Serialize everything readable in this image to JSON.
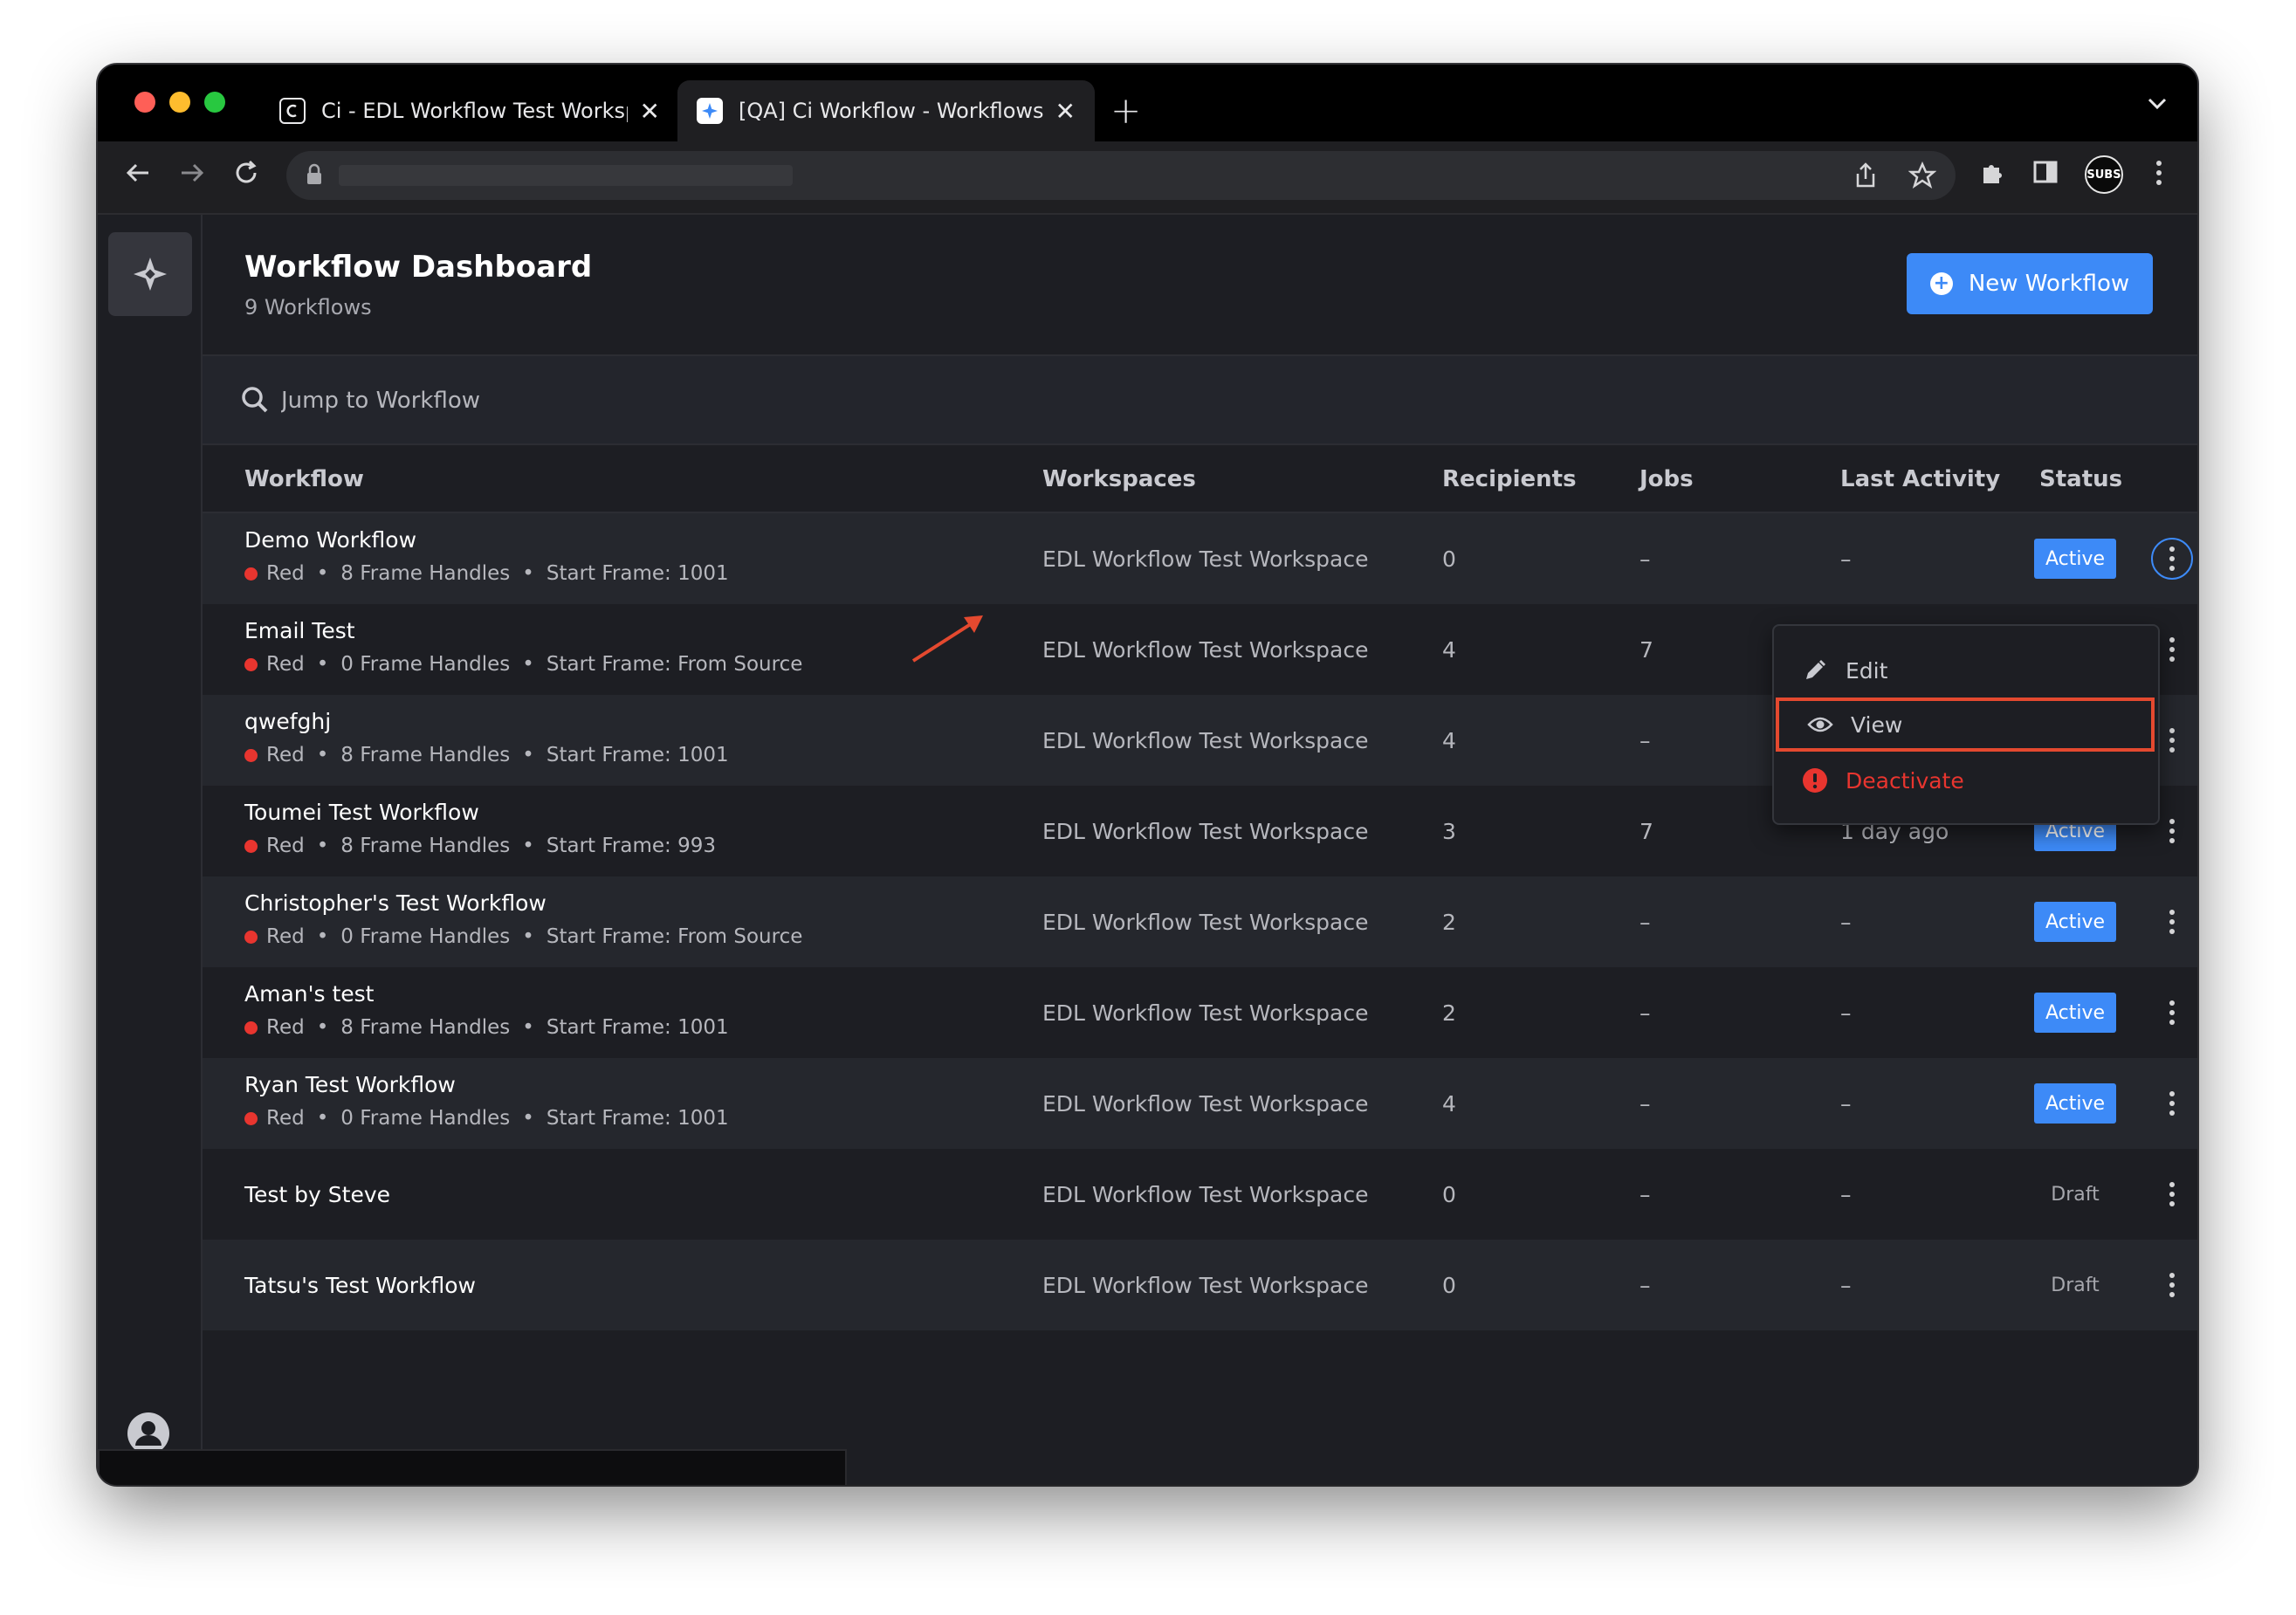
{
  "browser": {
    "tabs": [
      {
        "title": "Ci - EDL Workflow Test Workspace",
        "favicon": "ci-logo-icon",
        "active": false
      },
      {
        "title": "[QA] Ci Workflow - Workflows",
        "favicon": "workflow-diamond-icon",
        "active": true
      }
    ],
    "profile_label": "SUBS"
  },
  "header": {
    "title": "Workflow Dashboard",
    "subtitle": "9 Workflows",
    "new_button": "New Workflow"
  },
  "search": {
    "placeholder": "Jump to Workflow"
  },
  "table": {
    "columns": [
      "Workflow",
      "Workspaces",
      "Recipients",
      "Jobs",
      "Last Activity",
      "Status"
    ],
    "rows": [
      {
        "name": "Demo Workflow",
        "color": "Red",
        "handles": "8 Frame Handles",
        "start": "Start Frame: 1001",
        "workspace": "EDL Workflow Test Workspace",
        "recipients": "0",
        "jobs": "–",
        "last_activity": "–",
        "status": "Active"
      },
      {
        "name": "Email Test",
        "color": "Red",
        "handles": "0 Frame Handles",
        "start": "Start Frame: From Source",
        "workspace": "EDL Workflow Test Workspace",
        "recipients": "4",
        "jobs": "7",
        "last_activity": "",
        "status": ""
      },
      {
        "name": "qwefghj",
        "color": "Red",
        "handles": "8 Frame Handles",
        "start": "Start Frame: 1001",
        "workspace": "EDL Workflow Test Workspace",
        "recipients": "4",
        "jobs": "–",
        "last_activity": "",
        "status": ""
      },
      {
        "name": "Toumei Test Workflow",
        "color": "Red",
        "handles": "8 Frame Handles",
        "start": "Start Frame: 993",
        "workspace": "EDL Workflow Test Workspace",
        "recipients": "3",
        "jobs": "7",
        "last_activity": "1 day ago",
        "status": "Active"
      },
      {
        "name": "Christopher's Test Workflow",
        "color": "Red",
        "handles": "0 Frame Handles",
        "start": "Start Frame: From Source",
        "workspace": "EDL Workflow Test Workspace",
        "recipients": "2",
        "jobs": "–",
        "last_activity": "–",
        "status": "Active"
      },
      {
        "name": "Aman's test",
        "color": "Red",
        "handles": "8 Frame Handles",
        "start": "Start Frame: 1001",
        "workspace": "EDL Workflow Test Workspace",
        "recipients": "2",
        "jobs": "–",
        "last_activity": "–",
        "status": "Active"
      },
      {
        "name": "Ryan Test Workflow",
        "color": "Red",
        "handles": "0 Frame Handles",
        "start": "Start Frame: 1001",
        "workspace": "EDL Workflow Test Workspace",
        "recipients": "4",
        "jobs": "–",
        "last_activity": "–",
        "status": "Active"
      },
      {
        "name": "Test by Steve",
        "color": "",
        "handles": "",
        "start": "",
        "workspace": "EDL Workflow Test Workspace",
        "recipients": "0",
        "jobs": "–",
        "last_activity": "–",
        "status": "Draft"
      },
      {
        "name": "Tatsu's Test Workflow",
        "color": "",
        "handles": "",
        "start": "",
        "workspace": "EDL Workflow Test Workspace",
        "recipients": "0",
        "jobs": "–",
        "last_activity": "–",
        "status": "Draft"
      }
    ]
  },
  "row_menu": {
    "items": [
      {
        "label": "Edit",
        "icon": "pencil-icon"
      },
      {
        "label": "View",
        "icon": "eye-icon"
      },
      {
        "label": "Deactivate",
        "icon": "alert-icon"
      }
    ]
  },
  "colors": {
    "accent": "#3d8af7",
    "danger": "#e8352f",
    "highlight": "#e4492f",
    "background": "#1d1e23"
  }
}
